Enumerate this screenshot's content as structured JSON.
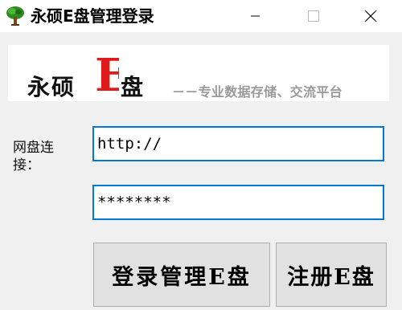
{
  "window": {
    "title": "永硕E盘管理登录",
    "icons": {
      "app": "tree-icon",
      "minimize": "minimize-icon",
      "maximize": "maximize-icon",
      "close": "close-icon"
    }
  },
  "banner": {
    "logo_main": "永硕",
    "logo_e": "E",
    "logo_pan": "盘",
    "tagline": "－－专业数据存储、交流平台",
    "colors": {
      "logo_e": "#e01a1a",
      "tagline": "#9a9a9a"
    }
  },
  "form": {
    "label": "网盘连接：",
    "url_value": "http://",
    "password_value": "********"
  },
  "buttons": {
    "login": "登录管理E盘",
    "register": "注册E盘"
  },
  "colors": {
    "focus_border": "#0078d7",
    "window_bg": "#f0f0f0"
  }
}
